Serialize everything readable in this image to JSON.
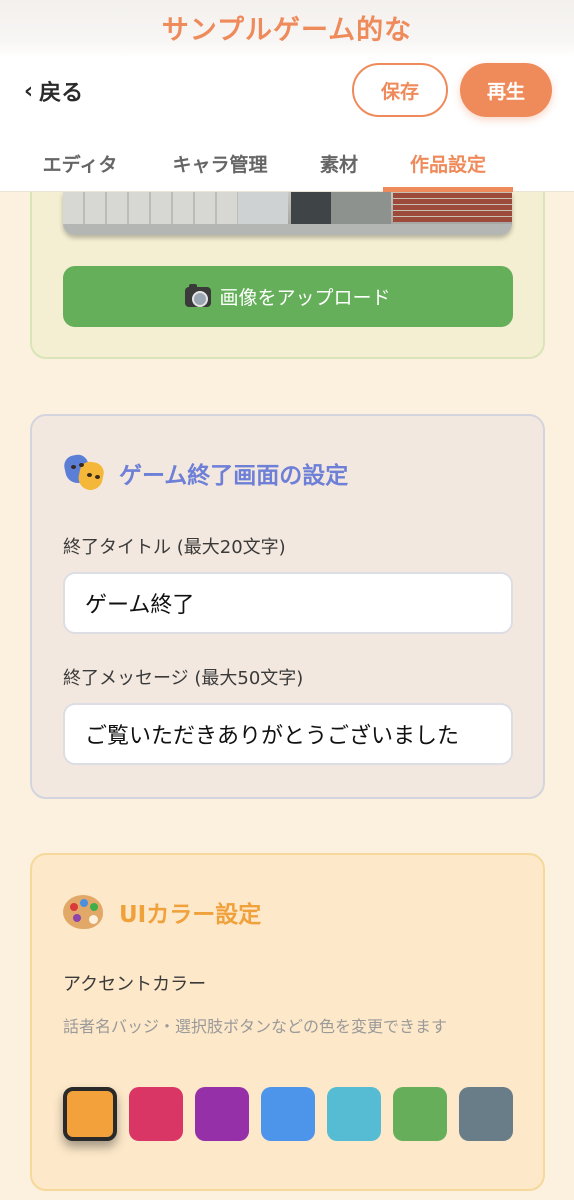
{
  "header": {
    "game_title": "サンプルゲーム的な",
    "back_label": "戻る",
    "save_label": "保存",
    "play_label": "再生"
  },
  "tabs": [
    {
      "label": "エディタ",
      "active": false
    },
    {
      "label": "キャラ管理",
      "active": false
    },
    {
      "label": "素材",
      "active": false
    },
    {
      "label": "作品設定",
      "active": true
    }
  ],
  "image_section": {
    "upload_label": "画像をアップロード"
  },
  "end_screen": {
    "heading": "ゲーム終了画面の設定",
    "title_label": "終了タイトル (最大20文字)",
    "title_value": "ゲーム終了",
    "message_label": "終了メッセージ (最大50文字)",
    "message_value": "ご覧いただきありがとうございました"
  },
  "ui_color": {
    "heading": "UIカラー設定",
    "accent_label": "アクセントカラー",
    "help_text": "話者名バッジ・選択肢ボタンなどの色を変更できます",
    "swatches": [
      {
        "color": "#f2a13b",
        "selected": true
      },
      {
        "color": "#d93565",
        "selected": false
      },
      {
        "color": "#9530a8",
        "selected": false
      },
      {
        "color": "#4c95ea",
        "selected": false
      },
      {
        "color": "#56bcd3",
        "selected": false
      },
      {
        "color": "#66ae59",
        "selected": false
      },
      {
        "color": "#697d88",
        "selected": false
      }
    ]
  },
  "colors": {
    "accent": "#ef8a5b",
    "end_heading": "#6d7fd6",
    "color_heading": "#f0a13b",
    "upload_button": "#65af5a"
  },
  "icons": {
    "back": "chevron-left-icon",
    "upload": "camera-icon",
    "end_screen": "theater-masks-icon",
    "ui_color": "palette-icon"
  }
}
